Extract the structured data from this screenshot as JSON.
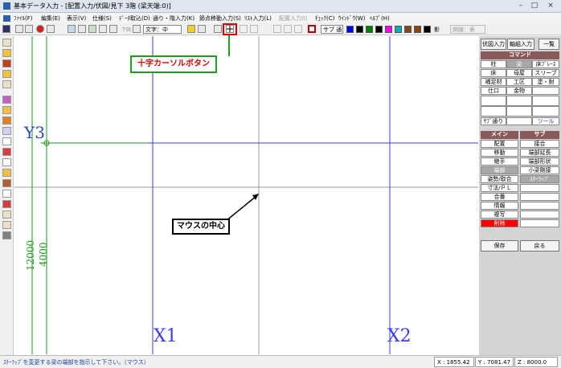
{
  "window": {
    "title": "基本データ入力 - [配置入力/伏図/見下 3階 (梁天端:0)]",
    "controls": [
      "–",
      "□",
      "×"
    ]
  },
  "menubar": {
    "items": [
      {
        "label": "ﾌｧｲﾙ(F)"
      },
      {
        "label": "編集(E)"
      },
      {
        "label": "表示(V)"
      },
      {
        "label": "仕様(S)"
      },
      {
        "label": "ﾃﾞｰﾀ取込(D)"
      },
      {
        "label": "通り・階入力(K)"
      },
      {
        "label": "節点移動入力(S)"
      },
      {
        "label": "ﾘｽﾄ入力(L)"
      },
      {
        "label": "配置入力(I)"
      },
      {
        "label": "ﾁｪｯｸ(C)"
      },
      {
        "label": "ｳｲﾝﾄﾞｳ(W)"
      },
      {
        "label": "ﾍﾙﾌﾟ(H)"
      }
    ]
  },
  "toolbar": {
    "layer_prefix": "下図",
    "text_size_select": "文字：中",
    "sub_toggle": "サブ 通",
    "swatch_colors": [
      "#0000ff",
      "#000000",
      "#008000",
      "#000000",
      "#ff00ff",
      "#00b0b0",
      "#8b4513",
      "#8b4513",
      "#000000"
    ],
    "shadow_label": "影",
    "line_select": "網線：表"
  },
  "annotations": {
    "crosshair_callout": "十字カーソルボタン",
    "mouse_center_callout": "マウスの中心"
  },
  "canvas": {
    "grid_labels": {
      "y3": "Y3",
      "x1": "X1",
      "x2": "X2"
    },
    "dimensions": {
      "outer": "12000",
      "inner": "4000"
    }
  },
  "right_panel": {
    "top_tabs": [
      "伏図入力",
      "軸組入力",
      "一覧"
    ],
    "command_header": "コマンド",
    "command_rows": [
      [
        "柱",
        "梁",
        "床ﾌﾞﾚｰｽ"
      ],
      [
        "床",
        "母屋",
        "スリーブ"
      ],
      [
        "補足材",
        "工区",
        "塗・耐"
      ],
      [
        "仕口",
        "金物",
        ""
      ],
      [
        "",
        "",
        ""
      ],
      [
        "",
        "",
        ""
      ]
    ],
    "sub_command_row": [
      "ｻﾌﾞ通り",
      "",
      "ツール"
    ],
    "main_header": "メイン",
    "sub_header": "サブ",
    "main_buttons": [
      "配置",
      "移動",
      "継手",
      "端部",
      "姿勢/取合",
      "寸法/ＰＬ",
      "合番",
      "情報",
      "複写",
      "削除"
    ],
    "sub_buttons": [
      "接合",
      "端部延長",
      "端部形状",
      "小梁剛接",
      "ｽﾁｰﾗｯﾌﾟ",
      "",
      "",
      "",
      "",
      ""
    ],
    "save_label": "保存",
    "back_label": "戻る"
  },
  "status": {
    "message": "ｽﾁｰﾗｯﾌﾟを変更する梁の端部を指示して下さい。（マウス）",
    "x_value": "X : 1855.42",
    "y_value": "Y : 7081.47",
    "z_value": "Z : 8000.0"
  },
  "colors": {
    "grid_line": "#3a3aff",
    "dimension_line": "#1a9a1a",
    "y3_label": "#2a4ab0",
    "callout_border": "#1aa01a",
    "highlight_box": "#e00000",
    "command_header_bg": "#8a5a5a",
    "delete_button": "#ff0000"
  }
}
